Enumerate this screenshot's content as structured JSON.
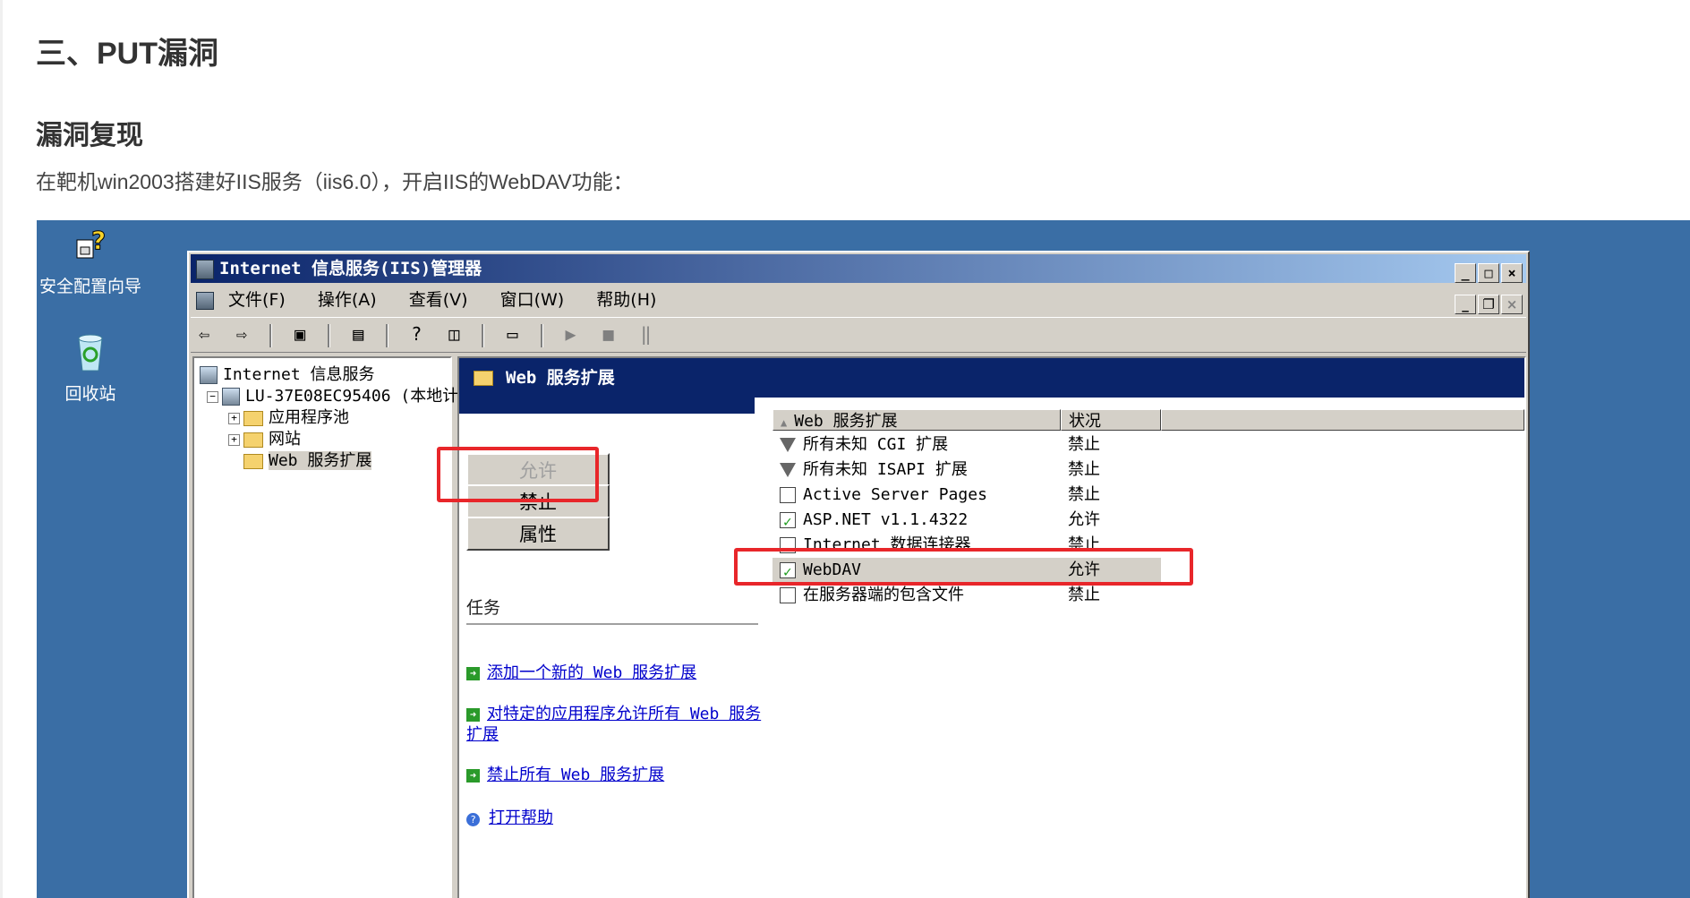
{
  "article": {
    "heading1": "三、PUT漏洞",
    "heading2": "漏洞复现",
    "paragraph": "在靶机win2003搭建好IIS服务（iis6.0），开启IIS的WebDAV功能："
  },
  "desktop": {
    "icons": [
      {
        "label": "安全配置向导",
        "icon": "security-wizard-icon"
      },
      {
        "label": "回收站",
        "icon": "recycle-bin-icon"
      }
    ]
  },
  "window": {
    "title": "Internet 信息服务(IIS)管理器",
    "menu": [
      "文件(F)",
      "操作(A)",
      "查看(V)",
      "窗口(W)",
      "帮助(H)"
    ],
    "tree": {
      "root": "Internet 信息服务",
      "server": "LU-37E08EC95406 (本地计",
      "children": [
        "应用程序池",
        "网站",
        "Web 服务扩展"
      ]
    },
    "content_title": "Web 服务扩展",
    "buttons": {
      "allow": "允许",
      "deny": "禁止",
      "properties": "属性"
    },
    "tasks_title": "任务",
    "tasks": [
      "添加一个新的 Web 服务扩展",
      "对特定的应用程序允许所有 Web 服务扩展",
      "禁止所有 Web 服务扩展",
      "打开帮助"
    ],
    "list_columns": [
      "Web 服务扩展",
      "状况"
    ],
    "list_rows": [
      {
        "name": "所有未知 CGI 扩展",
        "status": "禁止",
        "icon": "filter-icon"
      },
      {
        "name": "所有未知 ISAPI 扩展",
        "status": "禁止",
        "icon": "filter-icon"
      },
      {
        "name": "Active Server Pages",
        "status": "禁止",
        "icon": "doc-icon"
      },
      {
        "name": "ASP.NET v1.1.4322",
        "status": "允许",
        "icon": "allowed-doc-icon"
      },
      {
        "name": "Internet 数据连接器",
        "status": "禁止",
        "icon": "doc-icon"
      },
      {
        "name": "WebDAV",
        "status": "允许",
        "icon": "allowed-doc-icon"
      },
      {
        "name": "在服务器端的包含文件",
        "status": "禁止",
        "icon": "doc-icon"
      }
    ]
  },
  "highlight_color": "#e8262a"
}
